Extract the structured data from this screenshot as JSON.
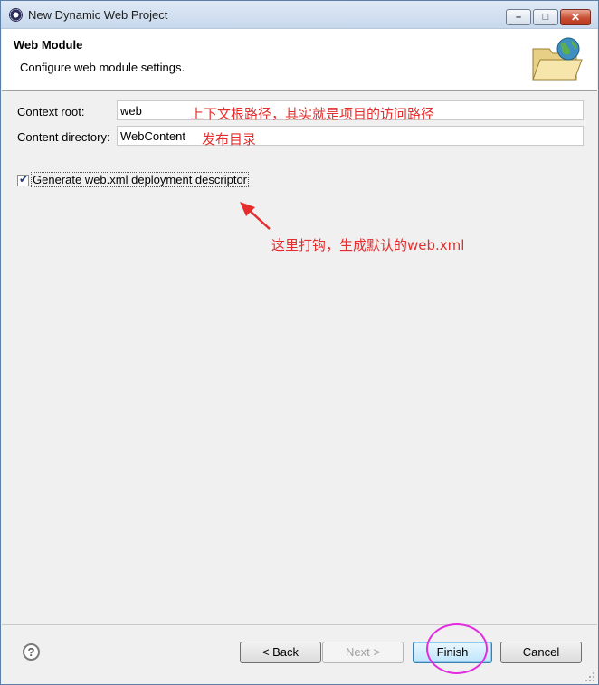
{
  "window": {
    "title": "New Dynamic Web Project",
    "controls": {
      "minimize": "–",
      "maximize": "□",
      "close": "✕"
    }
  },
  "header": {
    "title": "Web Module",
    "subtitle": "Configure web module settings.",
    "icon": "web-folder-globe-icon"
  },
  "form": {
    "context_root": {
      "label": "Context root:",
      "value": "web"
    },
    "content_directory": {
      "label": "Content directory:",
      "value": "WebContent"
    },
    "generate_descriptor": {
      "label": "Generate web.xml deployment descriptor",
      "checked": true,
      "check_glyph": "✔"
    }
  },
  "annotations": {
    "context_root_note": "上下文根路径，其实就是项目的访问路径",
    "content_dir_note": "发布目录",
    "checkbox_note": "这里打钩，生成默认的web.xml",
    "color": "#e52d2d",
    "highlight_color": "#e22ce0"
  },
  "buttons": {
    "help": "?",
    "back": "< Back",
    "next": "Next >",
    "finish": "Finish",
    "cancel": "Cancel"
  }
}
